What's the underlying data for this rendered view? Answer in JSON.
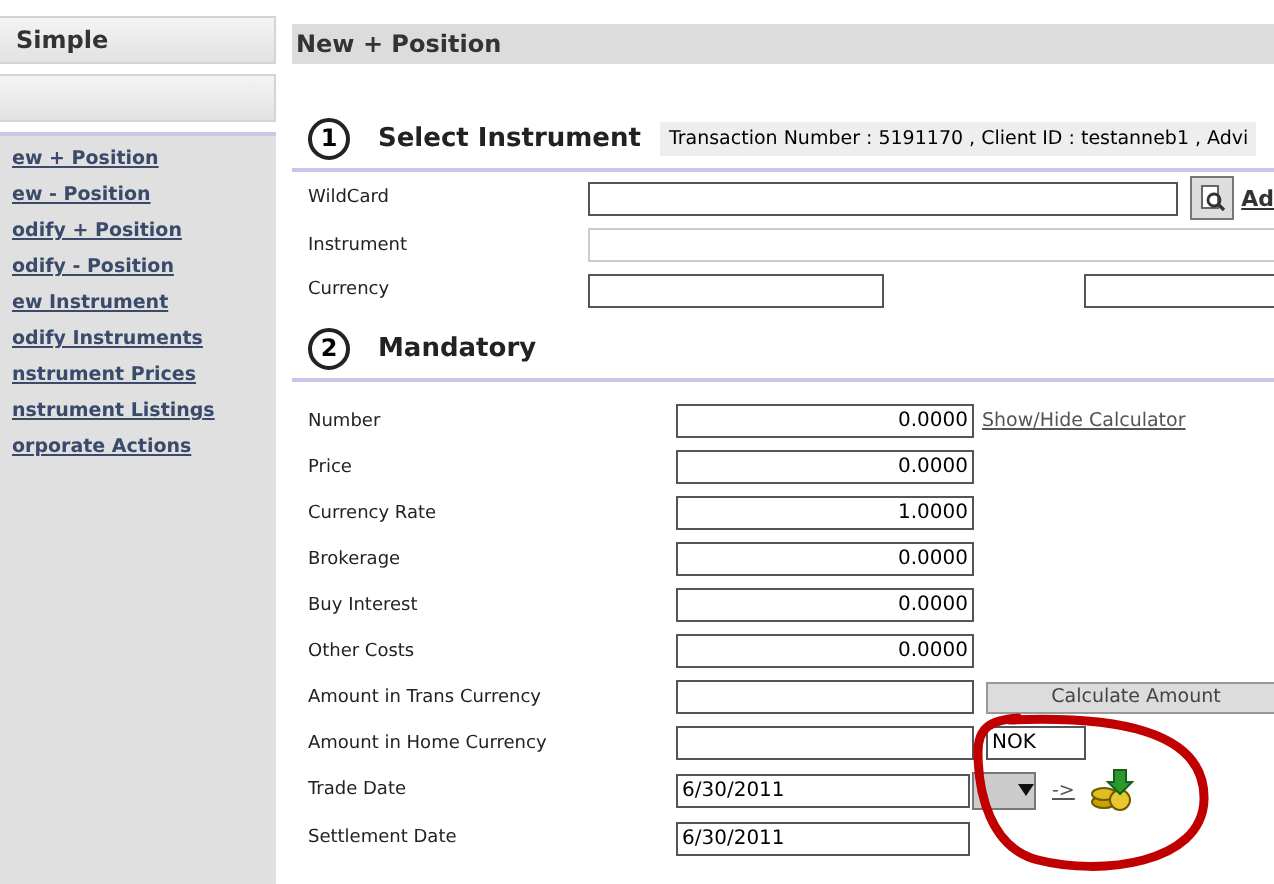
{
  "sidebar": {
    "title": "Simple",
    "items": [
      {
        "label": "ew + Position"
      },
      {
        "label": "ew - Position"
      },
      {
        "label": "odify + Position"
      },
      {
        "label": "odify - Position"
      },
      {
        "label": "ew Instrument"
      },
      {
        "label": "odify Instruments"
      },
      {
        "label": "nstrument Prices"
      },
      {
        "label": "nstrument Listings"
      },
      {
        "label": "orporate Actions"
      }
    ]
  },
  "page_title": "New + Position",
  "section_1": {
    "number": "1",
    "title": "Select Instrument",
    "info": "Transaction Number : 5191170 , Client ID : testanneb1 , Advi",
    "wildcard": {
      "label": "WildCard",
      "link": "Ad"
    },
    "instrument": {
      "label": "Instrument"
    },
    "currency": {
      "label": "Currency"
    }
  },
  "section_2": {
    "number": "2",
    "title": "Mandatory",
    "fields": [
      {
        "kind": "number",
        "label": "Number",
        "value": "0.0000",
        "link": "Show/Hide Calculator"
      },
      {
        "kind": "number",
        "label": "Price",
        "value": "0.0000"
      },
      {
        "kind": "number",
        "label": "Currency Rate",
        "value": "1.0000"
      },
      {
        "kind": "number",
        "label": "Brokerage",
        "value": "0.0000"
      },
      {
        "kind": "number",
        "label": "Buy Interest",
        "value": "0.0000"
      },
      {
        "kind": "number",
        "label": "Other Costs",
        "value": "0.0000"
      },
      {
        "kind": "button",
        "label": "Amount in Trans Currency",
        "button": "Calculate Amount"
      },
      {
        "kind": "currency",
        "label": "Amount in Home Currency",
        "currency": "NOK"
      },
      {
        "kind": "date",
        "label": "Trade Date",
        "value": "6/30/2011",
        "link": "->"
      },
      {
        "kind": "plain",
        "label": "Settlement Date",
        "value": "6/30/2011"
      }
    ]
  }
}
